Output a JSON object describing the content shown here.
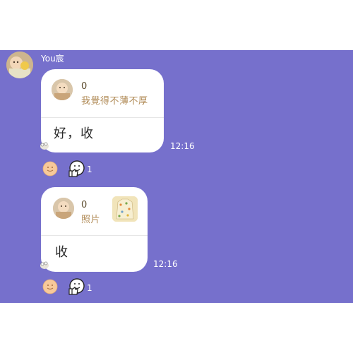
{
  "colors": {
    "chat_background": "#7670cc",
    "bubble": "#ffffff",
    "reply_text": "#b08a55",
    "meta_text": "#ffffff"
  },
  "sender": {
    "name": "You宸",
    "avatar_icon": "profile-photo"
  },
  "messages": [
    {
      "reply": {
        "name": "0",
        "text": "我覺得不薄不厚",
        "thumb_icon": "profile-photo"
      },
      "text": "好，收",
      "time": "12:16",
      "reactions": {
        "emoji": "smile-emoji",
        "sticker": "thumbs-up-sticker",
        "count": "1"
      }
    },
    {
      "reply": {
        "name": "0",
        "text": "照片",
        "thumb_icon": "profile-photo",
        "attachment_icon": "photo-thumbnail"
      },
      "text": "收",
      "time": "12:16",
      "reactions": {
        "emoji": "smile-emoji",
        "sticker": "thumbs-up-sticker",
        "count": "1"
      }
    }
  ]
}
